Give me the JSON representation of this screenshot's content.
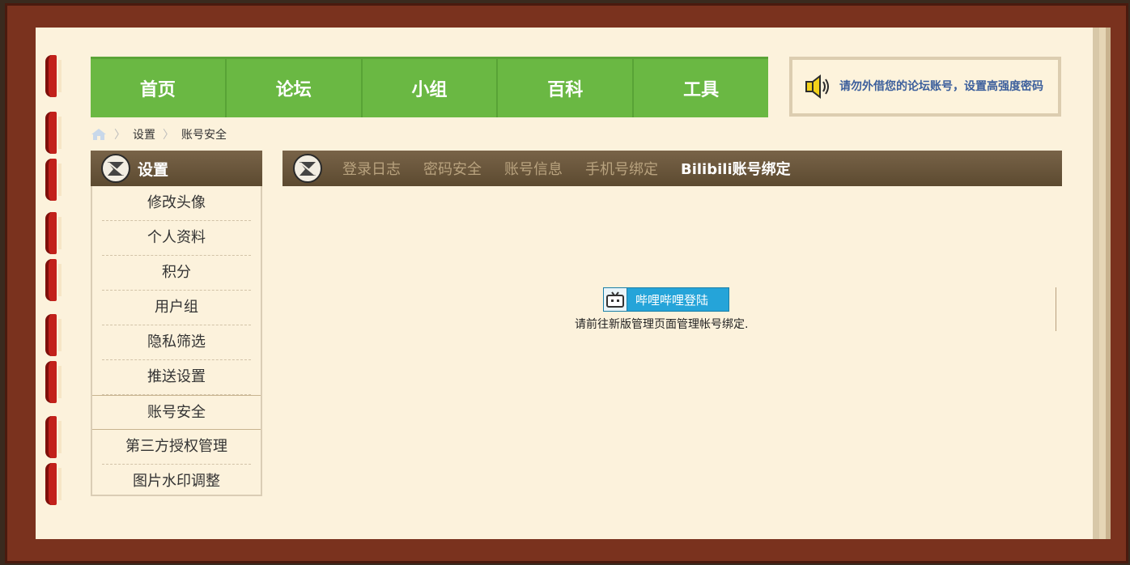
{
  "nav": [
    "首页",
    "论坛",
    "小组",
    "百科",
    "工具"
  ],
  "notice": {
    "text": "请勿外借您的论坛账号，设置高强度密码",
    "icon": "speaker-icon"
  },
  "breadcrumb": {
    "items": [
      "设置",
      "账号安全"
    ],
    "sep": "〉",
    "icon": "home-icon"
  },
  "sidebar": {
    "title": "设置",
    "items": [
      "修改头像",
      "个人资料",
      "积分",
      "用户组",
      "隐私筛选",
      "推送设置",
      "账号安全",
      "第三方授权管理",
      "图片水印调整"
    ],
    "active_index": 6
  },
  "tabs": [
    "登录日志",
    "密码安全",
    "账号信息",
    "手机号绑定",
    "Bilibili账号绑定"
  ],
  "active_tab": 4,
  "bilibili": {
    "button_label": "哔哩哔哩登陆",
    "hint": "请前往新版管理页面管理帐号绑定."
  },
  "colors": {
    "nav_green": "#6ab843",
    "header_brown": "#6a553b",
    "page_bg": "#fcf2dc",
    "bili_blue": "#25a4d9"
  }
}
